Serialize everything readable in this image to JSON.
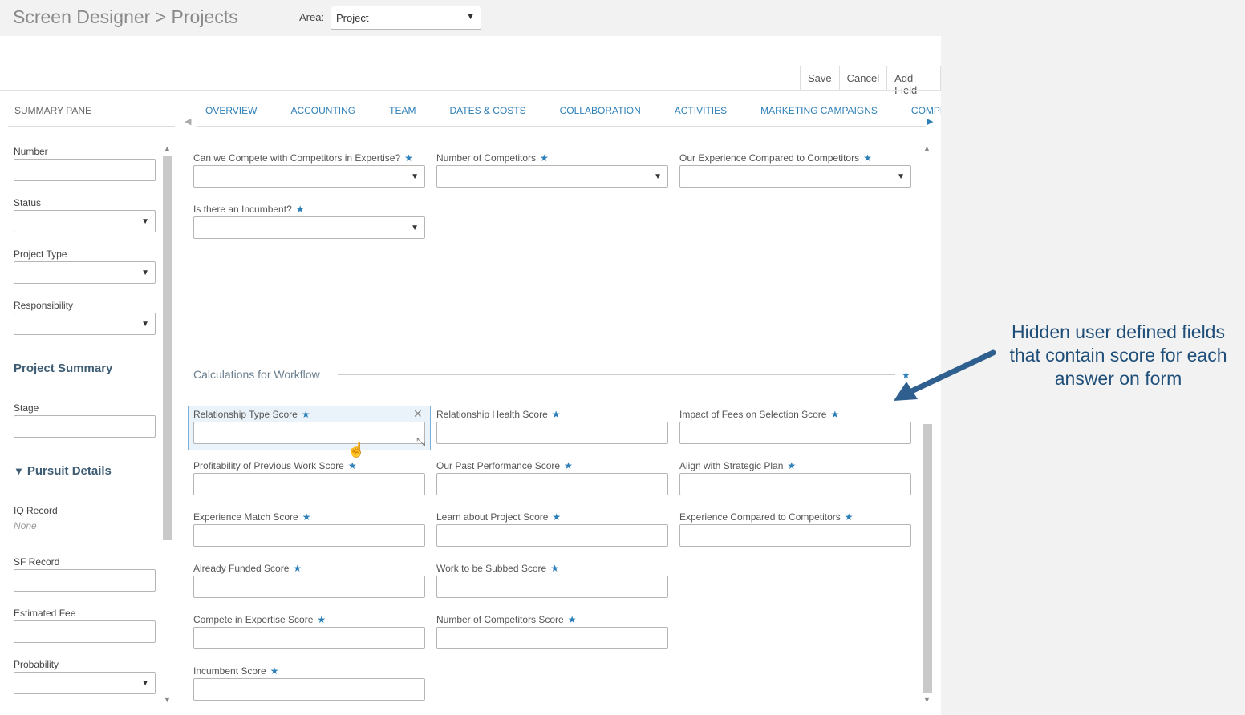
{
  "header": {
    "title": "Screen Designer > Projects",
    "area_label": "Area:",
    "area_value": "Project"
  },
  "toolbar": {
    "save": "Save",
    "cancel": "Cancel",
    "add_field": "Add Field"
  },
  "summary_pane_title": "SUMMARY PANE",
  "tabs": [
    "OVERVIEW",
    "ACCOUNTING",
    "TEAM",
    "DATES & COSTS",
    "COLLABORATION",
    "ACTIVITIES",
    "MARKETING CAMPAIGNS",
    "COMPETITION"
  ],
  "left_pane": {
    "number": "Number",
    "status": "Status",
    "project_type": "Project Type",
    "responsibility": "Responsibility",
    "project_summary": "Project Summary",
    "stage": "Stage",
    "pursuit_details": "Pursuit Details",
    "iq_record": "IQ Record",
    "iq_record_value": "None",
    "sf_record": "SF Record",
    "estimated_fee": "Estimated Fee",
    "probability": "Probability"
  },
  "competition_fields": {
    "compete_expertise": "Can we Compete with Competitors in Expertise?",
    "number_competitors": "Number of Competitors",
    "experience_compared": "Our Experience Compared to Competitors",
    "incumbent": "Is there an Incumbent?"
  },
  "section_title": "Calculations for Workflow",
  "score_fields": {
    "relationship_type": "Relationship Type Score",
    "relationship_health": "Relationship Health Score",
    "impact_fees": "Impact of Fees on Selection Score",
    "profitability": "Profitability of Previous Work Score",
    "past_performance": "Our Past Performance Score",
    "strategic_plan": "Align with Strategic Plan",
    "experience_match": "Experience Match Score",
    "learn_project": "Learn about Project Score",
    "experience_competitors": "Experience Compared to Competitors",
    "already_funded": "Already Funded Score",
    "work_subbed": "Work to be Subbed Score",
    "compete_expertise_score": "Compete in Expertise Score",
    "number_competitors_score": "Number of Competitors Score",
    "incumbent_score": "Incumbent Score"
  },
  "annotation": "Hidden user defined fields that contain score for each answer on form",
  "colors": {
    "accent": "#2d7fb8",
    "annotation": "#1f4e79",
    "selected_bg": "#eaf3fa"
  },
  "icons": [
    "star-icon",
    "close-icon",
    "resize-icon",
    "hand-cursor-icon",
    "caret-down-icon",
    "arrow-icon"
  ]
}
